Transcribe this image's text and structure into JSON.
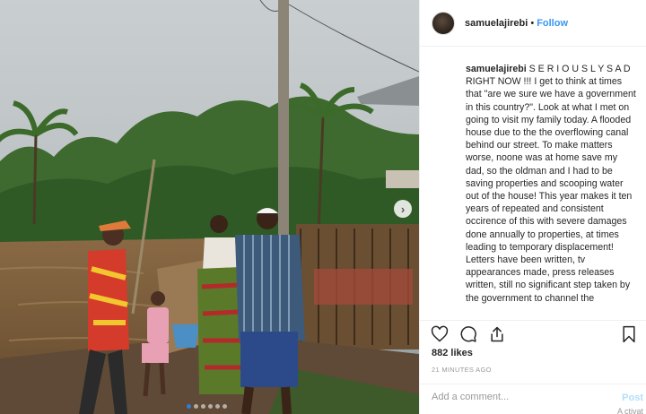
{
  "post": {
    "username": "samuelajirebi",
    "separator": "•",
    "follow_label": "Follow",
    "caption_text": "S E R I O U S L Y S A D RIGHT NOW !!! I get to think at times that \"are we sure we have a government in this country?\". Look at what I met on going to visit my family today. A flooded house due to the the overflowing canal behind our street. To make matters worse, noone was at home save my dad, so the oldman and I had to be saving properties and scooping water out of the house! This year makes it ten years of repeated and consistent occirence of this with severe damages done annually to properties, at times leading to temporary displacement! Letters have been written, tv appearances made, press releases written, still no significant step taken by the government to channel the",
    "likes": "882 likes",
    "timestamp": "21 MINUTES AGO",
    "comment_placeholder": "Add a comment...",
    "post_label": "Post",
    "activity_partial": "A ctivat"
  },
  "carousel": {
    "next_glyph": "›",
    "slide_count": 6,
    "active_index": 0
  },
  "icons": {
    "like": "heart-icon",
    "comment": "comment-icon",
    "share": "share-icon",
    "save": "bookmark-icon",
    "next": "chevron-right-icon"
  },
  "colors": {
    "link_blue": "#3897f0",
    "post_disabled": "#b2dffc",
    "muted": "#999999",
    "border": "#efefef",
    "active_dot": "#2f7dd9"
  }
}
